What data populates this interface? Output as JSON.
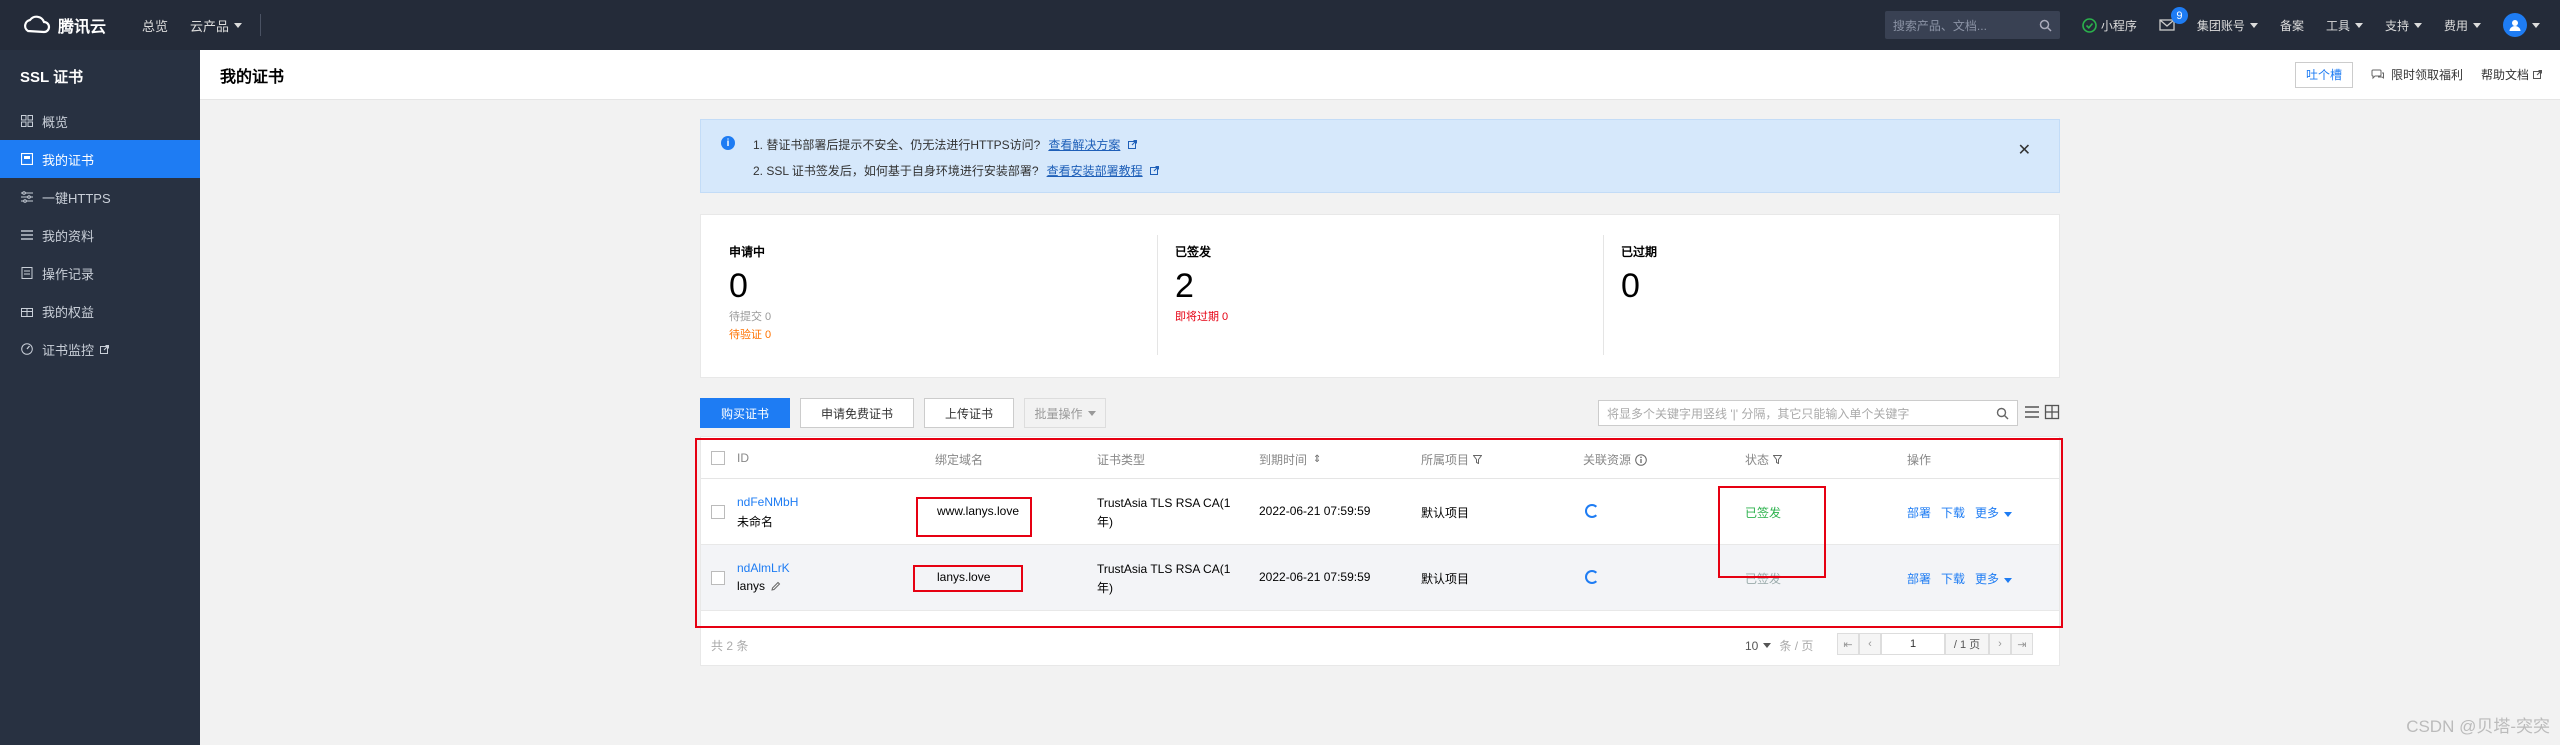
{
  "topbar": {
    "logo_text": "腾讯云",
    "nav": [
      "总览",
      "云产品"
    ],
    "search_placeholder": "搜索产品、文档...",
    "mini_program": "小程序",
    "mail_badge": "9",
    "items": [
      "集团账号",
      "备案",
      "工具",
      "支持",
      "费用"
    ]
  },
  "sidebar": {
    "title": "SSL 证书",
    "items": [
      {
        "label": "概览"
      },
      {
        "label": "我的证书"
      },
      {
        "label": "一键HTTPS"
      },
      {
        "label": "我的资料"
      },
      {
        "label": "操作记录"
      },
      {
        "label": "我的权益"
      },
      {
        "label": "证书监控"
      }
    ]
  },
  "header": {
    "title": "我的证书",
    "feedback": "吐个槽",
    "benefit": "限时领取福利",
    "help": "帮助文档"
  },
  "alert": {
    "line1": "1. 替证书部署后提示不安全、仍无法进行HTTPS访问?",
    "link1": "查看解决方案",
    "line2": "2. SSL 证书签发后，如何基于自身环境进行安装部署?",
    "link2": "查看安装部署教程"
  },
  "stats": [
    {
      "label": "申请中",
      "value": "0",
      "sub1": "待提交 0",
      "sub2": "待验证 0"
    },
    {
      "label": "已签发",
      "value": "2",
      "sub1": "即将过期 0",
      "sub2": ""
    },
    {
      "label": "已过期",
      "value": "0",
      "sub1": "",
      "sub2": ""
    }
  ],
  "toolbar": {
    "buy": "购买证书",
    "apply_free": "申请免费证书",
    "upload": "上传证书",
    "batch": "批量操作",
    "search_placeholder": "将显多个关键字用竖线 '|' 分隔，其它只能输入单个关键字"
  },
  "table": {
    "headers": [
      "ID",
      "绑定域名",
      "证书类型",
      "到期时间",
      "所属项目",
      "关联资源",
      "状态",
      "操作"
    ],
    "rows": [
      {
        "id": "ndFeNMbH",
        "alias": "未命名",
        "domain": "www.lanys.love",
        "type_line1": "TrustAsia TLS RSA CA(1",
        "type_line2": "年)",
        "expire": "2022-06-21 07:59:59",
        "project": "默认项目",
        "status": "已签发",
        "deploy": "部署",
        "download": "下载",
        "more": "更多"
      },
      {
        "id": "ndAlmLrK",
        "alias": "lanys",
        "domain": "lanys.love",
        "type_line1": "TrustAsia TLS RSA CA(1",
        "type_line2": "年)",
        "expire": "2022-06-21 07:59:59",
        "project": "默认项目",
        "status": "已签发",
        "deploy": "部署",
        "download": "下载",
        "more": "更多"
      }
    ],
    "total": "共 2 条",
    "page_size": "10",
    "page_size_suffix": "条 / 页",
    "current_page": "1",
    "total_pages": "/ 1 页"
  },
  "watermark": "CSDN @贝塔-突突",
  "colors": {
    "accent": "#1e7cf3",
    "topbar": "#242b39",
    "sidebar": "#283141",
    "success": "#2bb24c",
    "warning": "#ff7200",
    "annotation": "#e60012"
  }
}
